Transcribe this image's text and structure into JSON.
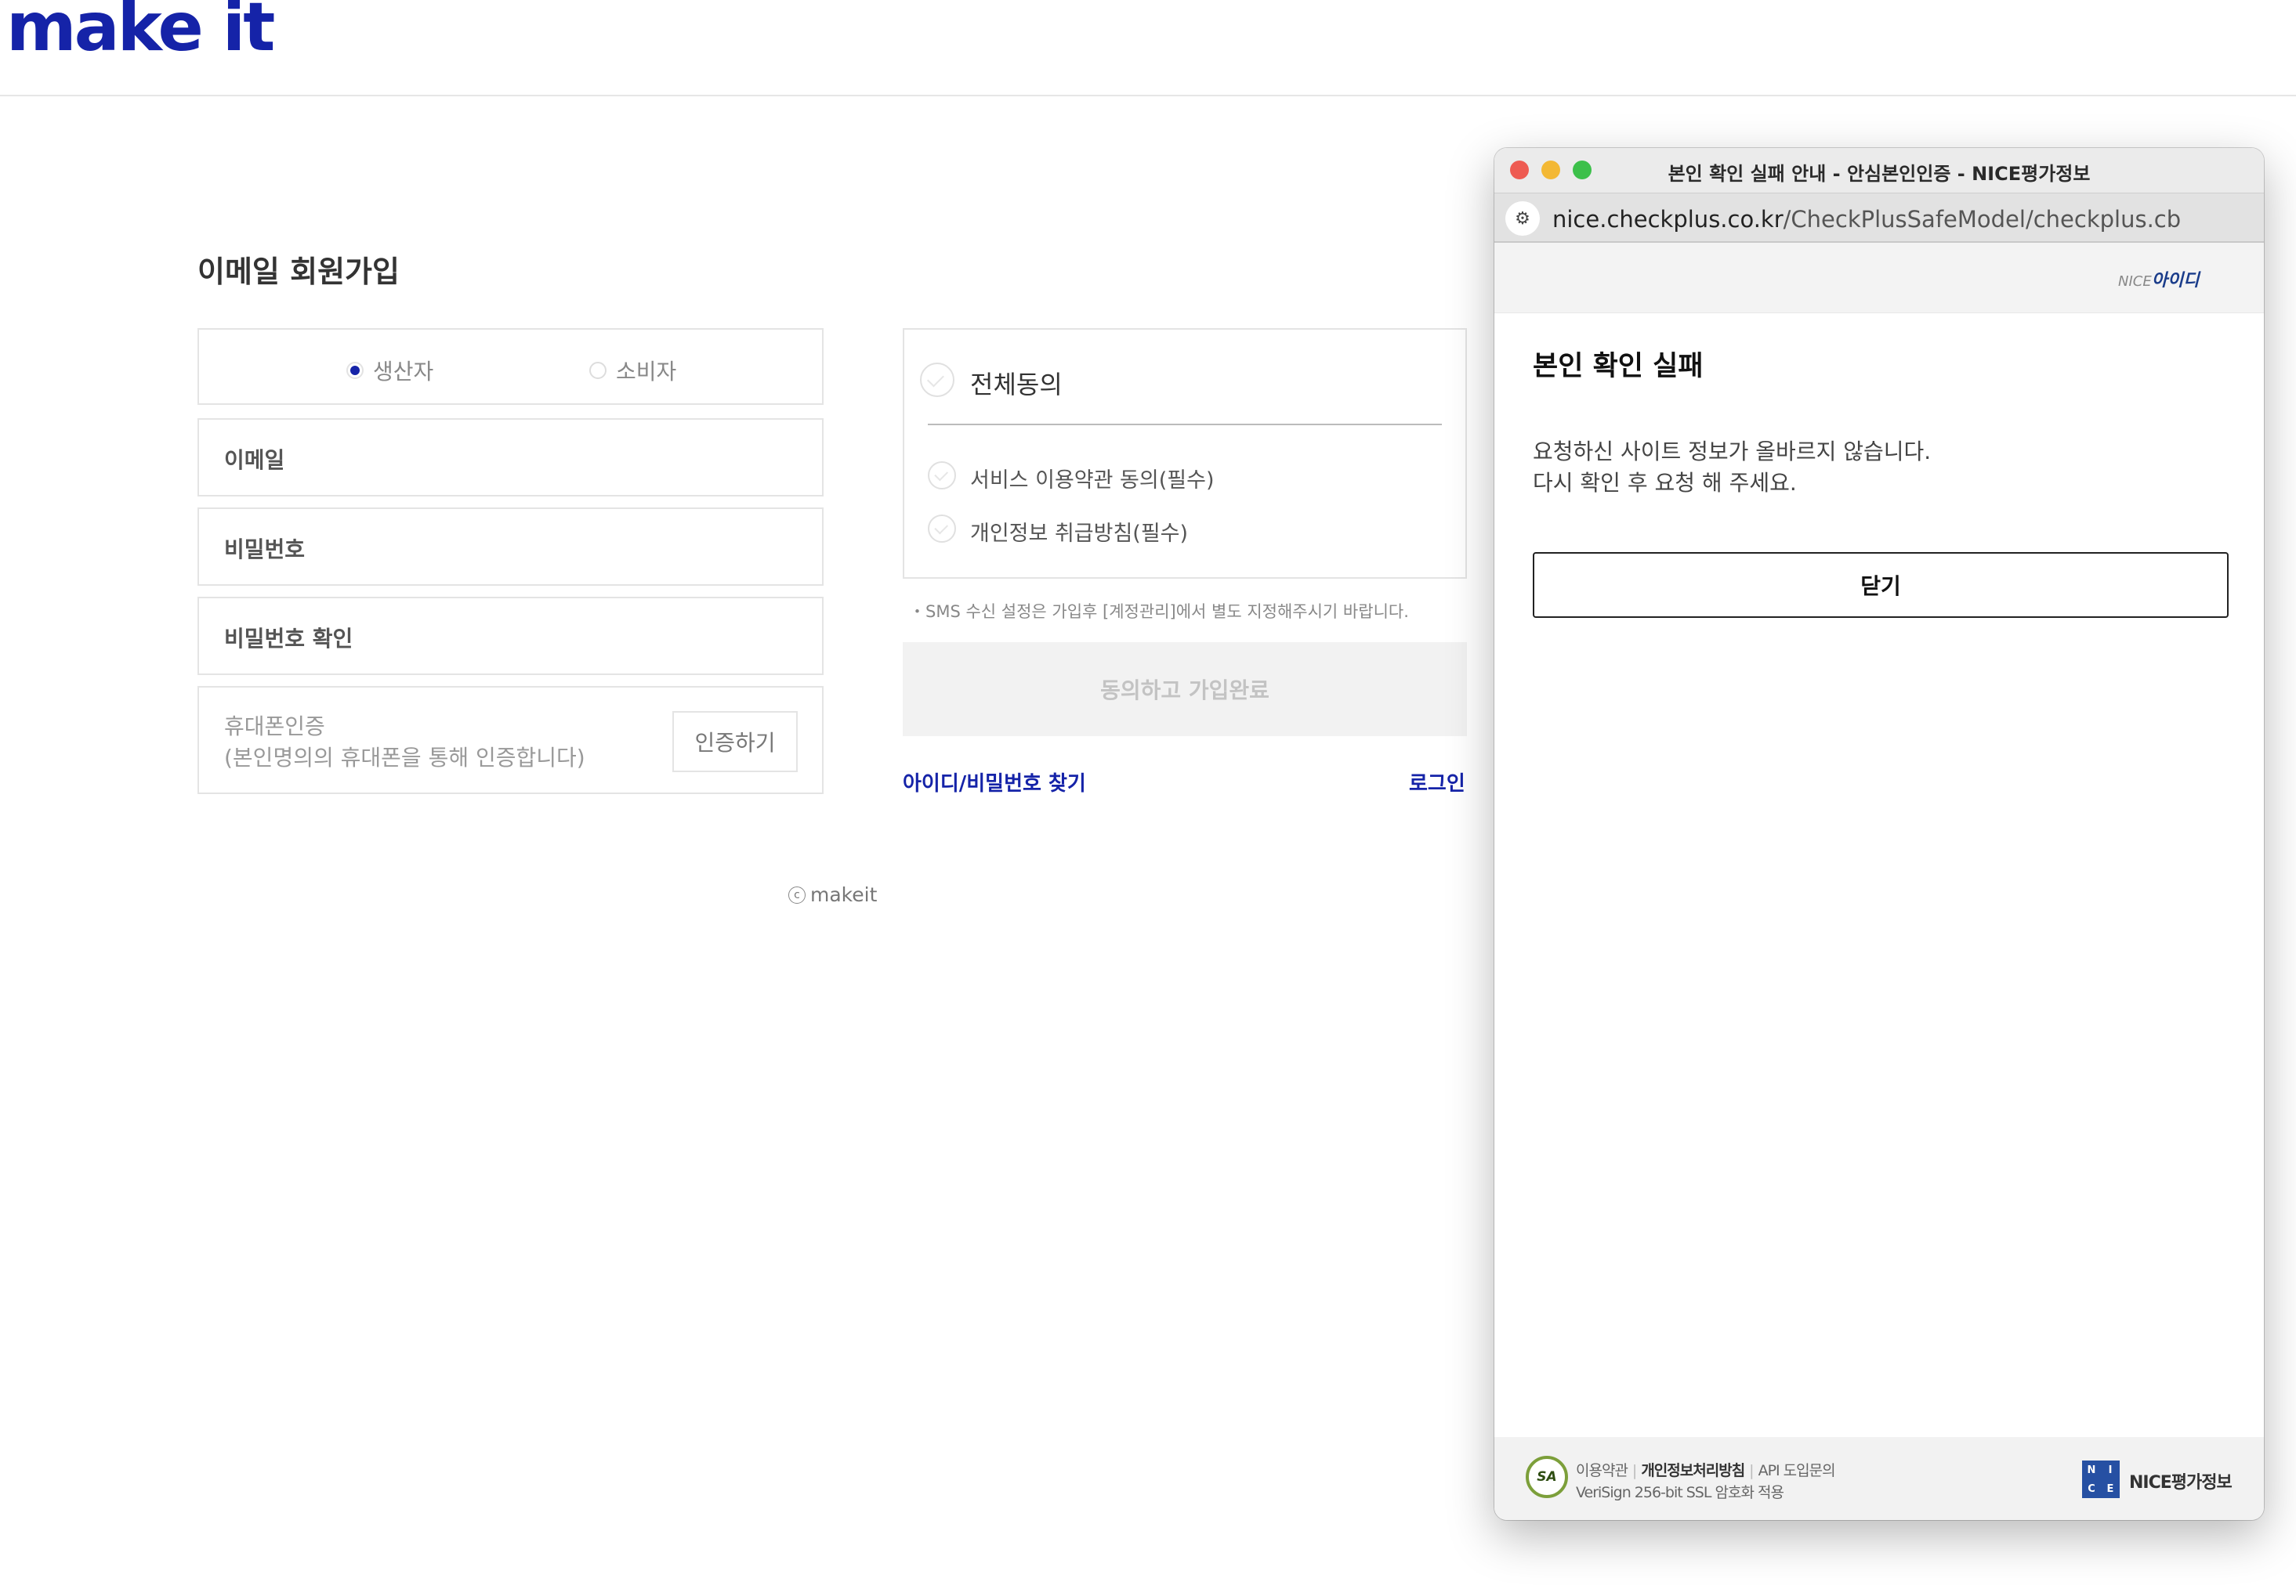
{
  "brand": {
    "logo": "make it",
    "color": "#1523a8"
  },
  "signup": {
    "title": "이메일 회원가입",
    "member_types": [
      {
        "label": "생산자",
        "selected": true
      },
      {
        "label": "소비자",
        "selected": false
      }
    ],
    "fields": {
      "email": "이메일",
      "password": "비밀번호",
      "password_confirm": "비밀번호 확인"
    },
    "phone": {
      "label": "휴대폰인증",
      "description": "(본인명의의 휴대폰을 통해 인증합니다)",
      "button": "인증하기"
    },
    "agreements": {
      "all": "전체동의",
      "items": [
        "서비스 이용약관 동의(필수)",
        "개인정보 취급방침(필수)"
      ]
    },
    "sms_note": "・SMS 수신 설정은 가입후 [계정관리]에서 별도 지정해주시기 바랍니다.",
    "submit": "동의하고 가입완료",
    "find_account": "아이디/비밀번호 찾기",
    "login": "로그인"
  },
  "footer": {
    "copyright": "makeit"
  },
  "popup": {
    "window_title": "본인 확인 실패 안내 - 안심본인인증 - NICE평가정보",
    "url_host": "nice.checkplus.co.kr",
    "url_path": "/CheckPlusSafeModel/checkplus.cb",
    "header_logo": {
      "prefix": "NICE",
      "name": "아이디"
    },
    "heading": "본인 확인 실패",
    "message_line1": "요청하신 사이트 정보가 올바르지 않습니다.",
    "message_line2": "다시 확인 후 요청 해 주세요.",
    "close_button": "닫기",
    "footer": {
      "seal": "SA",
      "terms": "이용약관",
      "privacy": "개인정보처리방침",
      "api": "API 도입문의",
      "ssl": "VeriSign 256-bit SSL 암호화 적용",
      "company": "NICE평가정보",
      "mark_letters": [
        "N",
        "I",
        "C",
        "E"
      ]
    }
  }
}
